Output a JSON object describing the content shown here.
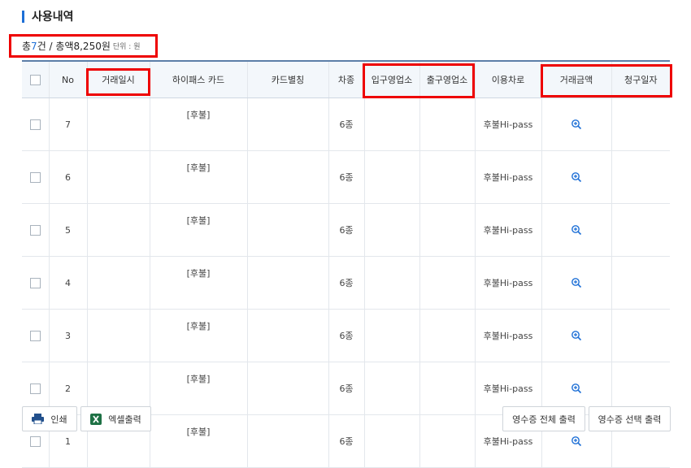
{
  "section": {
    "title": "사용내역"
  },
  "summary": {
    "prefix": "총 ",
    "count": "7",
    "middle": "건 / 총액 ",
    "total": "8,250원",
    "unit": "단위 : 원"
  },
  "table": {
    "headers": [
      "No",
      "거래일시",
      "하이패스 카드",
      "카드별칭",
      "차종",
      "입구영업소",
      "출구영업소",
      "이용차로",
      "거래금액",
      "청구일자"
    ],
    "rows": [
      {
        "no": "7",
        "card": "[후불]",
        "type": "6종",
        "lane": "후불Hi-pass"
      },
      {
        "no": "6",
        "card": "[후불]",
        "type": "6종",
        "lane": "후불Hi-pass"
      },
      {
        "no": "5",
        "card": "[후불]",
        "type": "6종",
        "lane": "후불Hi-pass"
      },
      {
        "no": "4",
        "card": "[후불]",
        "type": "6종",
        "lane": "후불Hi-pass"
      },
      {
        "no": "3",
        "card": "[후불]",
        "type": "6종",
        "lane": "후불Hi-pass"
      },
      {
        "no": "2",
        "card": "[후불]",
        "type": "6종",
        "lane": "후불Hi-pass"
      },
      {
        "no": "1",
        "card": "[후불]",
        "type": "6종",
        "lane": "후불Hi-pass"
      }
    ]
  },
  "buttons": {
    "print": "인쇄",
    "excel": "엑셀출력",
    "receipt_all": "영수증 전체 출력",
    "receipt_selected": "영수증 선택 출력"
  },
  "icons": {
    "print": "printer-icon",
    "excel": "excel-icon",
    "zoom": "zoom-in-icon"
  },
  "colors": {
    "accent": "#1d6fd6",
    "highlight": "#ee0000",
    "header_bg": "#f3f7fb"
  }
}
